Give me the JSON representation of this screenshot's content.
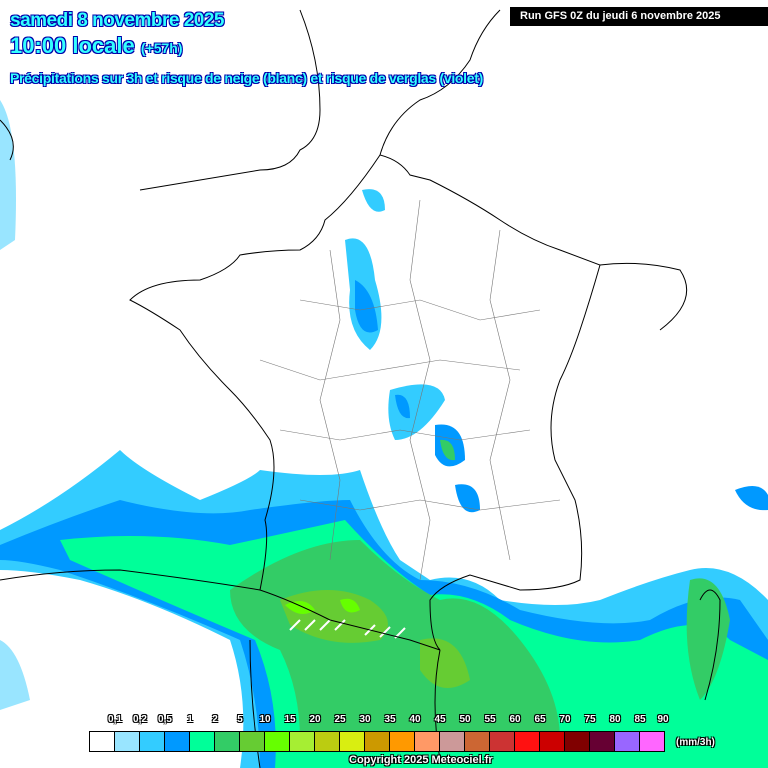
{
  "header": {
    "date": "samedi 8 novembre 2025",
    "time": "10:00 locale",
    "offset": "(+57h)",
    "subtitle": "Précipitations sur 3h et risque de neige (blanc) et risque de verglas (violet)",
    "run": "Run GFS 0Z du jeudi 6 novembre 2025"
  },
  "legend": {
    "labels": [
      "0,1",
      "0,2",
      "0,5",
      "1",
      "2",
      "5",
      "10",
      "15",
      "20",
      "25",
      "30",
      "35",
      "40",
      "45",
      "50",
      "55",
      "60",
      "65",
      "70",
      "75",
      "80",
      "85",
      "90"
    ],
    "colors": [
      "#ffffff",
      "#99e5ff",
      "#33ccff",
      "#0099ff",
      "#00ff99",
      "#33cc66",
      "#66cc33",
      "#66ff00",
      "#a6ee33",
      "#bbcc11",
      "#d9ee11",
      "#cc9900",
      "#ff9900",
      "#ff9966",
      "#cc9999",
      "#cc6633",
      "#cc3333",
      "#ff1111",
      "#cc0000",
      "#800000",
      "#660033",
      "#9966ff",
      "#ff66ff"
    ],
    "unit": "(mm/3h)"
  },
  "copyright": "Copyright 2025 Meteociel.fr"
}
